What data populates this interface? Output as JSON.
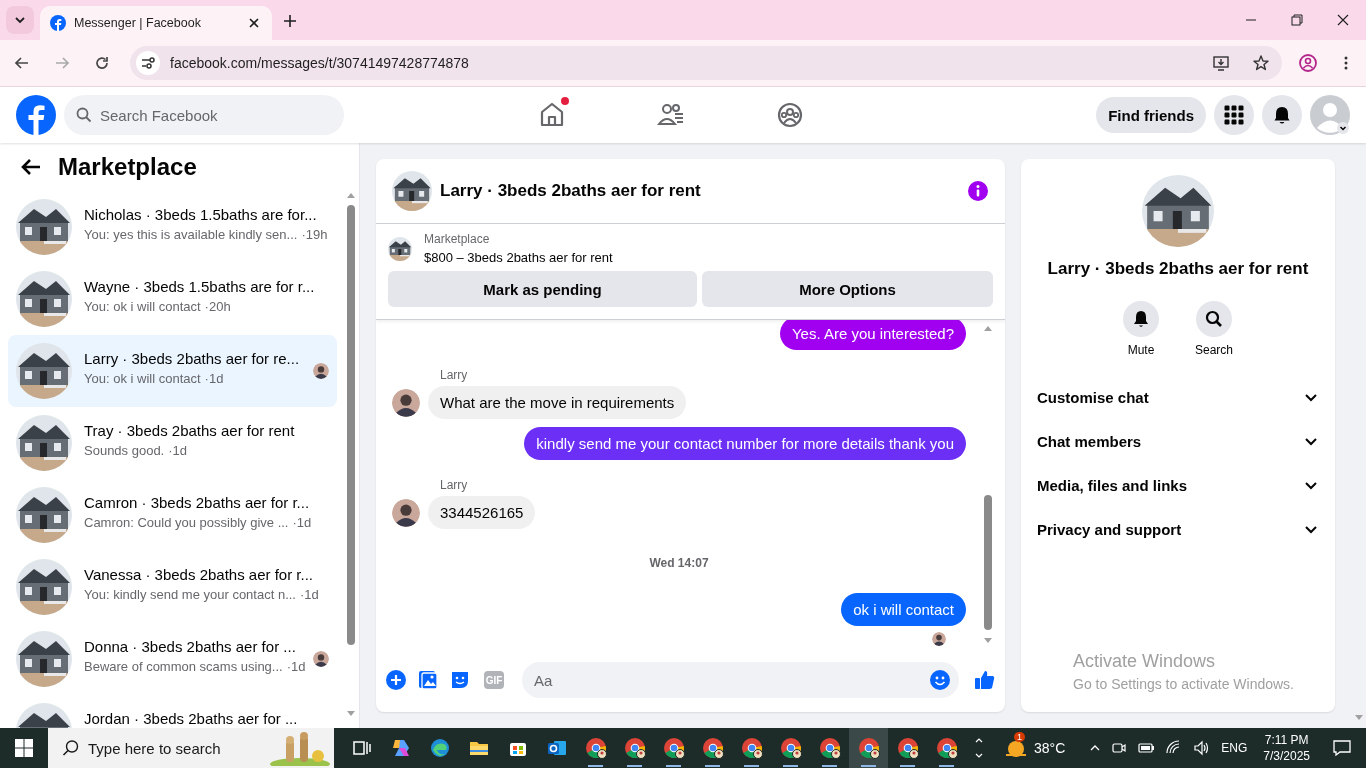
{
  "browser": {
    "tabs": [
      {
        "title": "Messenger | Facebook",
        "selected": true
      }
    ],
    "address": "facebook.com/messages/t/30741497428774878"
  },
  "topbar": {
    "search": {
      "placeholder": "Search Facebook"
    },
    "nav": [
      {
        "kind": "home",
        "badge": true
      },
      {
        "kind": "friends",
        "badge": false
      },
      {
        "kind": "groups",
        "badge": false
      }
    ],
    "find_friends": "Find friends"
  },
  "sidebar": {
    "title": "Marketplace",
    "conversations": [
      {
        "title": "Nicholas · 3beds 1.5baths are for...",
        "preview": "You: yes this is available kindly sen...",
        "time": "·19h",
        "selected": false,
        "seen": false
      },
      {
        "title": "Wayne · 3beds 1.5baths are for r...",
        "preview": "You: ok i will contact",
        "time": "·20h",
        "selected": false,
        "seen": false
      },
      {
        "title": "Larry · 3beds 2baths aer for re...",
        "preview": "You: ok i will contact",
        "time": "·1d",
        "selected": true,
        "seen": true
      },
      {
        "title": "Tray · 3beds 2baths aer for rent",
        "preview": "Sounds good.",
        "time": "·1d",
        "selected": false,
        "seen": false
      },
      {
        "title": "Camron · 3beds 2baths aer for r...",
        "preview": "Camron: Could you possibly give ...",
        "time": "·1d",
        "selected": false,
        "seen": false
      },
      {
        "title": "Vanessa · 3beds 2baths aer for r...",
        "preview": "You: kindly send me your contact n...",
        "time": "·1d",
        "selected": false,
        "seen": false
      },
      {
        "title": "Donna · 3beds 2baths aer for ...",
        "preview": "Beware of common scams using...",
        "time": "·1d",
        "selected": false,
        "seen": true
      },
      {
        "title": "Jordan · 3beds 2baths aer for ...",
        "selected": false,
        "seen": false
      }
    ]
  },
  "chat": {
    "title": "Larry · 3beds 2baths aer for rent",
    "listing": {
      "label": "Marketplace",
      "item": "$800 – 3beds 2baths aer for rent"
    },
    "buttons": [
      "Mark as pending",
      "More Options"
    ],
    "messages": [
      {
        "kind": "out",
        "text": "Yes. Are you interested?",
        "color": "#a100f0"
      },
      {
        "kind": "in",
        "sender": "Larry",
        "text": "What are the move in requirements"
      },
      {
        "kind": "out",
        "text": "kindly send me your contact number for more details thank you",
        "color": "#6b2ff5"
      },
      {
        "kind": "in",
        "sender": "Larry",
        "text": "3344526165"
      },
      {
        "kind": "timestamp",
        "text": "Wed 14:07"
      },
      {
        "kind": "out",
        "text": "ok i will contact",
        "color": "#0866ff",
        "seen": true
      }
    ],
    "composer": {
      "gif": "GIF",
      "placeholder": "Aa"
    }
  },
  "details": {
    "title": "Larry · 3beds 2baths aer for rent",
    "actions": [
      {
        "kind": "mute",
        "label": "Mute"
      },
      {
        "kind": "search",
        "label": "Search"
      }
    ],
    "sections": [
      {
        "label": "Customise chat",
        "expanded": false
      },
      {
        "label": "Chat members",
        "expanded": false
      },
      {
        "label": "Media, files and links",
        "expanded": false
      },
      {
        "label": "Privacy and support",
        "expanded": false
      }
    ]
  },
  "activation": {
    "title": "Activate Windows",
    "subtitle": "Go to Settings to activate Windows."
  },
  "taskbar": {
    "search_placeholder": "Type here to search",
    "apps": [
      {
        "kind": "taskview",
        "selected": false
      },
      {
        "kind": "copilot",
        "selected": false
      },
      {
        "kind": "edge",
        "selected": false
      },
      {
        "kind": "explorer",
        "selected": false
      },
      {
        "kind": "store",
        "selected": false
      },
      {
        "kind": "outlook",
        "selected": false
      },
      {
        "kind": "chrome",
        "selected": false
      },
      {
        "kind": "chrome",
        "selected": false
      },
      {
        "kind": "chrome",
        "selected": false
      },
      {
        "kind": "chrome",
        "selected": false
      },
      {
        "kind": "chrome",
        "selected": false
      },
      {
        "kind": "chrome",
        "selected": false
      },
      {
        "kind": "chrome",
        "selected": false
      },
      {
        "kind": "chrome",
        "selected": true
      },
      {
        "kind": "chrome",
        "selected": false
      },
      {
        "kind": "chrome",
        "selected": false
      }
    ],
    "weather_badge": "1",
    "temperature": "38°C",
    "language": "ENG",
    "time": "7:11 PM",
    "date": "7/3/2025"
  }
}
